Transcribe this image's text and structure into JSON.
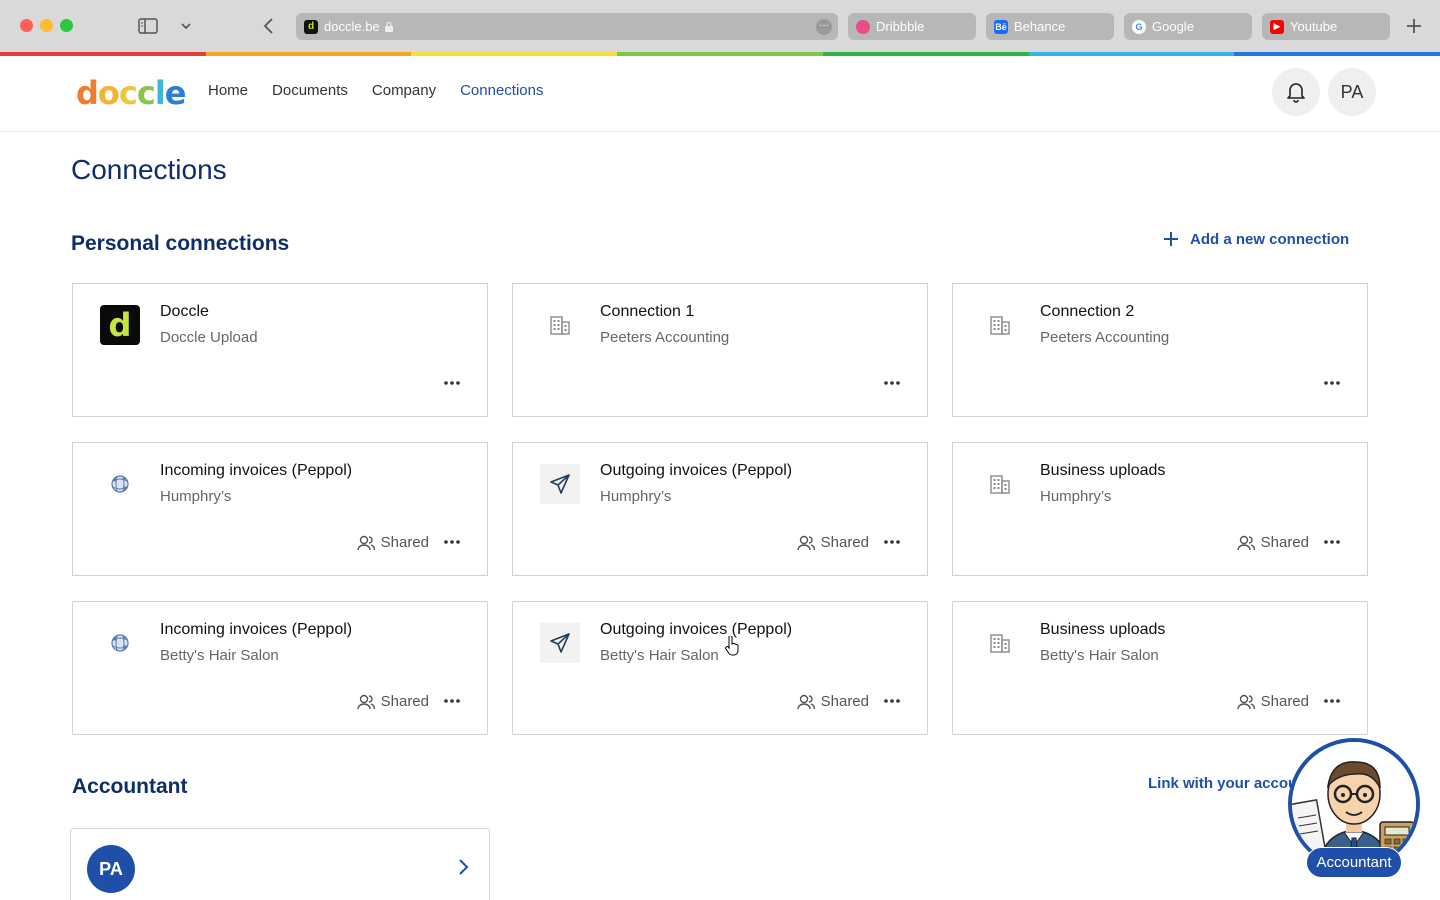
{
  "browser": {
    "url": "doccle.be",
    "tabs": [
      {
        "label": "Dribbble"
      },
      {
        "label": "Behance"
      },
      {
        "label": "Google"
      },
      {
        "label": "Youtube"
      }
    ],
    "rainbow_colors": [
      "#e23d3d",
      "#f5a623",
      "#f7e03c",
      "#7ac943",
      "#2fb34a",
      "#33b5e5",
      "#1f7adb"
    ]
  },
  "header": {
    "logo_text": "doccle",
    "nav": [
      "Home",
      "Documents",
      "Company",
      "Connections"
    ],
    "active_nav": "Connections",
    "avatar_initials": "PA"
  },
  "page": {
    "title": "Connections"
  },
  "personal": {
    "title": "Personal connections",
    "add_label": "Add a new connection",
    "cards": [
      {
        "title": "Doccle",
        "subtitle": "Doccle Upload",
        "icon": "doccle-logo",
        "shared": ""
      },
      {
        "title": "Connection 1",
        "subtitle": "Peeters Accounting",
        "icon": "building-icon",
        "shared": ""
      },
      {
        "title": "Connection 2",
        "subtitle": "Peeters Accounting",
        "icon": "building-icon",
        "shared": ""
      },
      {
        "title": "Incoming invoices (Peppol)",
        "subtitle": "Humphry’s",
        "icon": "peppol-icon",
        "shared": "Shared"
      },
      {
        "title": "Outgoing invoices (Peppol)",
        "subtitle": "Humphry’s",
        "icon": "send-icon",
        "shared": "Shared"
      },
      {
        "title": "Business uploads",
        "subtitle": "Humphry’s",
        "icon": "building-icon",
        "shared": "Shared"
      },
      {
        "title": "Incoming invoices (Peppol)",
        "subtitle": "Betty's Hair Salon",
        "icon": "peppol-icon",
        "shared": "Shared"
      },
      {
        "title": "Outgoing invoices (Peppol)",
        "subtitle": "Betty's Hair Salon",
        "icon": "send-icon",
        "shared": "Shared"
      },
      {
        "title": "Business uploads",
        "subtitle": "Betty's Hair Salon",
        "icon": "building-icon",
        "shared": "Shared"
      }
    ]
  },
  "accountant": {
    "title": "Accountant",
    "link_label": "Link with your accountant",
    "avatar_initials": "PA",
    "mascot_label": "Accountant"
  }
}
